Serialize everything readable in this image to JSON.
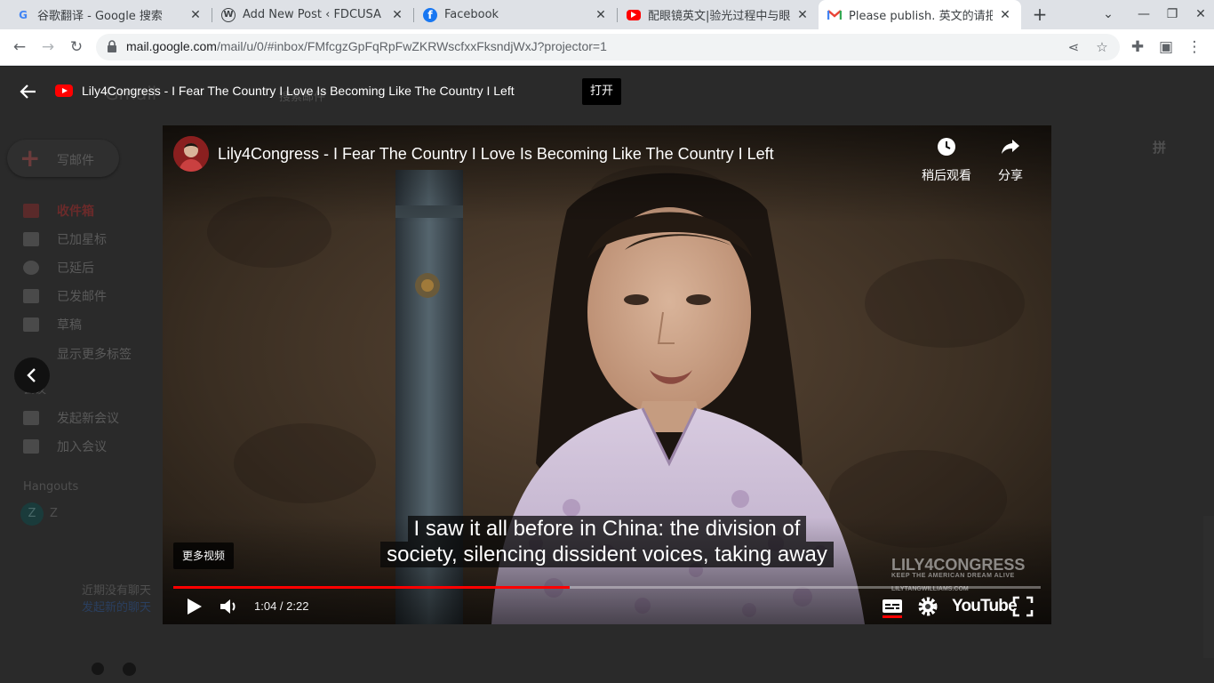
{
  "browser": {
    "tabs": [
      {
        "title": "谷歌翻译 - Google 搜索",
        "icon": "google-icon",
        "active": false
      },
      {
        "title": "Add New Post ‹ FDCUSA — W",
        "icon": "wordpress-icon",
        "active": false
      },
      {
        "title": "Facebook",
        "icon": "facebook-icon",
        "active": false
      },
      {
        "title": "配眼镜英文|验光过程中与眼科",
        "icon": "youtube-icon",
        "active": false
      },
      {
        "title": "Please publish. 英文的请把英",
        "icon": "gmail-icon",
        "active": true
      }
    ],
    "new_tab_label": "+",
    "url_host": "mail.google.com",
    "url_path": "/mail/u/0/#inbox/FMfcgzGpFqRpFwZKRWscfxxFksndjWxJ?projector=1"
  },
  "gmail_bg": {
    "compose_label": "写邮件",
    "nav_items": [
      {
        "label": "收件箱",
        "icon": "inbox-icon"
      },
      {
        "label": "已加星标",
        "icon": "star-icon"
      },
      {
        "label": "已延后",
        "icon": "clock-icon"
      },
      {
        "label": "已发邮件",
        "icon": "send-icon"
      },
      {
        "label": "草稿",
        "icon": "draft-icon"
      },
      {
        "label": "显示更多标签",
        "icon": "chevron-down-icon"
      }
    ],
    "meet_items": [
      {
        "label": "发起新会议",
        "icon": "video-icon"
      },
      {
        "label": "加入会议",
        "icon": "keyboard-icon"
      }
    ],
    "meet_heading": "会议",
    "hangouts_heading": "Hangouts",
    "hangouts_user": "Z",
    "no_chats": "近期没有聊天",
    "start_chat": "发起新的聊天",
    "pager_label": "拼",
    "search_placeholder": "搜索邮件"
  },
  "projector": {
    "title": "Lily4Congress - I Fear The Country I Love Is Becoming Like The Country I Left",
    "open_label": "打开"
  },
  "video": {
    "title": "Lily4Congress - I Fear The Country I Love Is Becoming Like The Country I Left",
    "watch_later_label": "稍后观看",
    "share_label": "分享",
    "more_videos_label": "更多视频",
    "caption_line1": "I saw it all before in China: the division of",
    "caption_line2": "society, silencing dissident voices, taking away",
    "watermark_main": "LILY4CONGRESS",
    "watermark_sub": "KEEP THE AMERICAN DREAM ALIVE",
    "watermark_url": "LILYTANGWILLIAMS.COM",
    "time_display": "1:04 / 2:22",
    "progress_fraction": 0.457,
    "youtube_label": "YouTube"
  },
  "colors": {
    "progress_red": "#ff0000",
    "tabstrip": "#dee1e6",
    "omnibox": "#f1f3f4"
  }
}
